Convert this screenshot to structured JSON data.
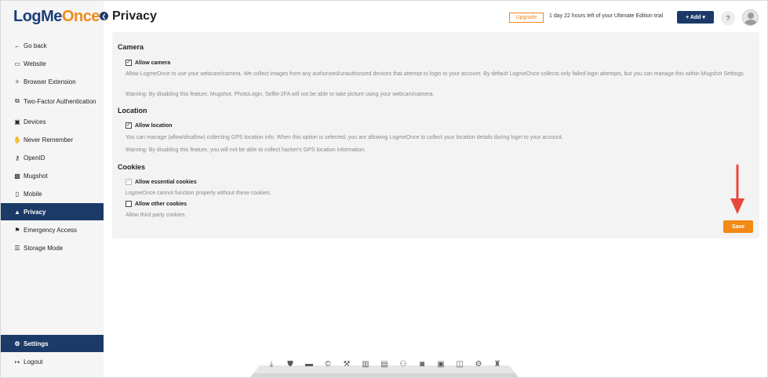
{
  "brand": {
    "logo_part1": "LogMe",
    "logo_part2": "Once"
  },
  "header": {
    "title": "Privacy",
    "upgrade_label": "Upgrade",
    "trial_text": "1 day 22 hours left of your Ultimate Edition trial",
    "add_label": "+ Add ▾",
    "help_label": "?"
  },
  "sidebar": {
    "items": [
      {
        "label": "Go back",
        "icon": "arrow-left-icon",
        "glyph": "←"
      },
      {
        "label": "Website",
        "icon": "window-icon",
        "glyph": "▭"
      },
      {
        "label": "Browser Extension",
        "icon": "puzzle-icon",
        "glyph": "✧"
      },
      {
        "label": "Two-Factor Authentication",
        "icon": "devices-icon",
        "glyph": "⧉"
      },
      {
        "label": "Devices",
        "icon": "monitor-phone-icon",
        "glyph": "▣"
      },
      {
        "label": "Never Remember",
        "icon": "hand-icon",
        "glyph": "✋"
      },
      {
        "label": "OpenID",
        "icon": "key-icon",
        "glyph": "⚷"
      },
      {
        "label": "Mugshot",
        "icon": "camera-icon",
        "glyph": "▩"
      },
      {
        "label": "Mobile",
        "icon": "mobile-icon",
        "glyph": "▯"
      },
      {
        "label": "Privacy",
        "icon": "user-lock-icon",
        "glyph": "▲"
      },
      {
        "label": "Emergency Access",
        "icon": "emergency-icon",
        "glyph": "⚑"
      },
      {
        "label": "Storage Mode",
        "icon": "database-icon",
        "glyph": "☰"
      }
    ],
    "settings_label": "Settings",
    "logout_label": "Logout",
    "active_item": "Privacy"
  },
  "camera": {
    "title": "Camera",
    "checkbox_label": "Allow camera",
    "checked": true,
    "description": "Allow LogmeOnce to use your webcam/camera. We collect images from any authorized/unauthorized devices that attempt to login to your account. By default LogmeOnce collects only failed login attempts, but you can manage this within Mugshot Settings.",
    "warning": "Warning: By disabling this feature, Mugshot, PhotoLogin, Selfie-2FA will not be able to take picture using your webcam/camera."
  },
  "location": {
    "title": "Location",
    "checkbox_label": "Allow location",
    "checked": true,
    "description": "You can manage (allow/disallow) collecting GPS location info. When this option is selected, you are allowing LogmeOnce to collect your location details during login to your account.",
    "warning": "Warning: By disabling this feature, you will not be able to collect hacker's GPS location information."
  },
  "cookies": {
    "title": "Cookies",
    "essential_label": "Allow essential cookies",
    "essential_checked": true,
    "essential_disabled": true,
    "essential_desc": "LogmeOnce cannot function properly without these cookies.",
    "other_label": "Allow other cookies",
    "other_checked": false,
    "other_desc": "Allow third party cookies."
  },
  "save_label": "Save",
  "colors": {
    "navy": "#1b3a68",
    "orange": "#f08a1c",
    "arrow_red": "#e8473c"
  },
  "dock_icons": [
    "download-icon",
    "shield-icon",
    "wallet-icon",
    "copyright-icon",
    "tools-icon",
    "chart-icon",
    "document-icon",
    "users-icon",
    "car-icon",
    "photo-icon",
    "cards-icon",
    "gear-icon",
    "graduation-icon"
  ]
}
